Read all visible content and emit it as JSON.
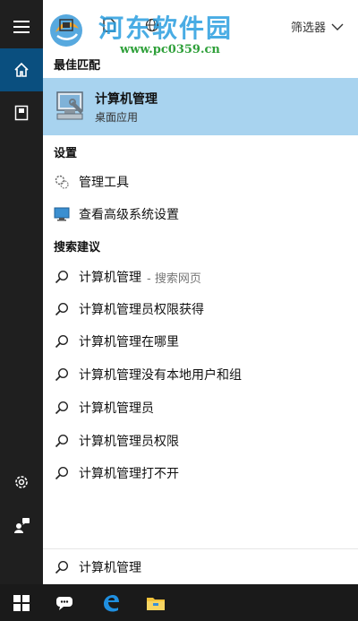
{
  "watermark": {
    "title": "河东软件园",
    "url": "www.pc0359.cn"
  },
  "header": {
    "filter_label": "筛选器"
  },
  "best_match": {
    "heading": "最佳匹配",
    "title": "计算机管理",
    "subtitle": "桌面应用"
  },
  "settings": {
    "heading": "设置",
    "items": [
      {
        "label": "管理工具",
        "icon": "gear-tools-icon"
      },
      {
        "label": "查看高级系统设置",
        "icon": "monitor-icon"
      }
    ]
  },
  "suggestions": {
    "heading": "搜索建议",
    "first": {
      "label": "计算机管理",
      "hint": "- 搜索网页"
    },
    "items": [
      "计算机管理员权限获得",
      "计算机管理在哪里",
      "计算机管理没有本地用户和组",
      "计算机管理员",
      "计算机管理员权限",
      "计算机管理打不开"
    ]
  },
  "search": {
    "query": "计算机管理"
  },
  "colors": {
    "accent": "#0a4f7f",
    "highlight": "#a8d3ef",
    "rail": "#1f1f1f"
  }
}
